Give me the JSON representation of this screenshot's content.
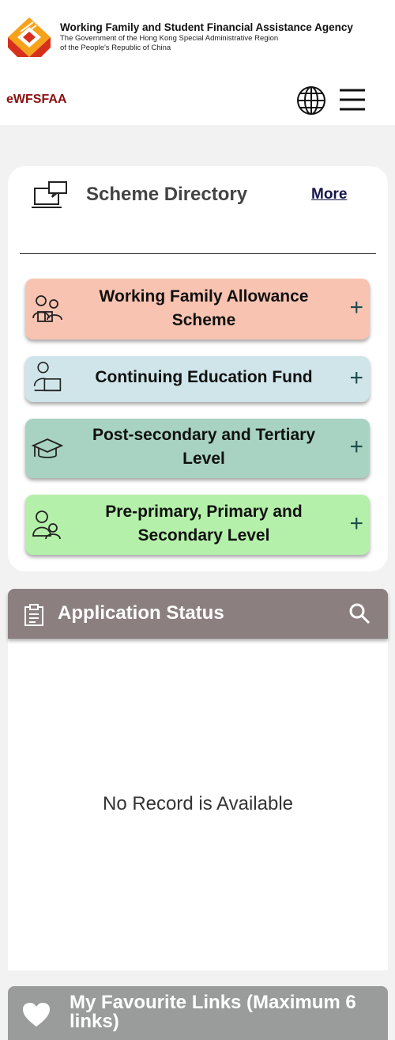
{
  "header": {
    "agency_name": "Working Family and Student Financial Assistance Agency",
    "government_line_1": "The Government of the Hong Kong Special Administrative Region",
    "government_line_2": "of the People's Republic of China",
    "brand": "eWFSFAA",
    "icons": [
      "agency-logo-icon",
      "globe-icon",
      "hamburger-menu-icon"
    ]
  },
  "scheme_directory": {
    "title": "Scheme Directory",
    "more_label": "More",
    "icon": "laptop-chat-icon",
    "items": [
      {
        "label": "Working Family Allowance Scheme",
        "icon": "family-reading-icon",
        "expand": "+",
        "color": "#f9c3b1"
      },
      {
        "label": "Continuing Education Fund",
        "icon": "person-laptop-icon",
        "expand": "+",
        "color": "#cfe5ea"
      },
      {
        "label": "Post-secondary and Tertiary Level",
        "icon": "graduation-cap-icon",
        "expand": "+",
        "color": "#a8d3c3"
      },
      {
        "label": "Pre-primary, Primary and Secondary Level",
        "icon": "students-icon",
        "expand": "+",
        "color": "#b4f0a9"
      }
    ]
  },
  "application_status": {
    "title": "Application Status",
    "icon": "clipboard-icon",
    "search_icon": "search-icon",
    "empty_message": "No Record is Available",
    "color": "#8c7f7f"
  },
  "favourite_links": {
    "title": "My Favourite Links (Maximum 6 links)",
    "icon": "heart-icon"
  }
}
